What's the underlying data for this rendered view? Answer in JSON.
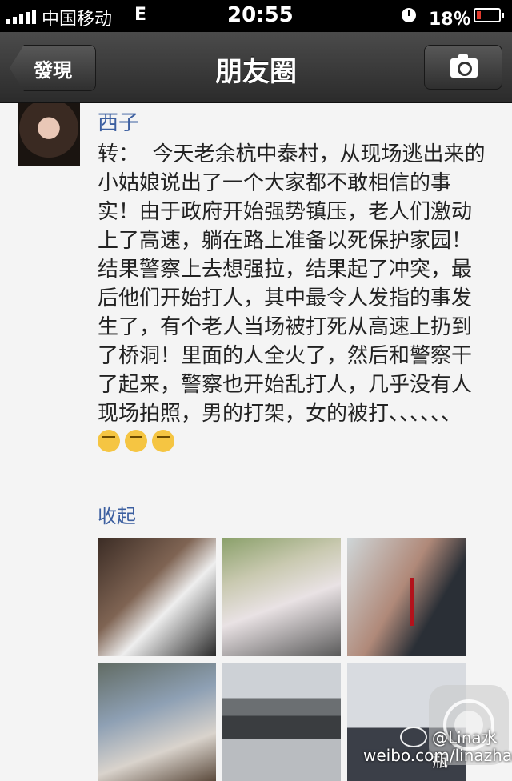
{
  "status_bar": {
    "carrier": "中国移动",
    "network": "E",
    "time": "20:55",
    "battery": "18％",
    "battery_fraction": 0.18,
    "battery_color": "#e23a2d",
    "icons": [
      "signal-bars-icon",
      "clock-icon",
      "battery-icon"
    ]
  },
  "nav": {
    "back_label": "發現",
    "title": "朋友圈",
    "right_button_icon": "camera-icon"
  },
  "post": {
    "author": "西子",
    "text": "转：  今天老余杭中泰村，从现场逃出来的小姑娘说出了一个大家都不敢相信的事实！由于政府开始强势镇压，老人们激动上了高速，躺在路上准备以死保护家园！\n结果警察上去想强拉，结果起了冲突，最后他们开始打人，其中最令人发指的事发生了，有个老人当场被打死从高速上扔到了桥洞！里面的人全火了，然后和警察干了起来，警察也开始乱打人，几乎没有人现场拍照，男的打架，女的被打、、、、、、",
    "emojis": [
      "crying-emoji-icon",
      "crying-emoji-icon",
      "crying-emoji-icon"
    ],
    "collapse_label": "收起",
    "photos": [
      "photo-1",
      "photo-2",
      "photo-3",
      "photo-4",
      "photo-5",
      "photo-6"
    ]
  },
  "watermark": {
    "handle": "@Lina水瓶",
    "url": "weibo.com/linazhang"
  },
  "accent_link_color": "#3c5fa0"
}
